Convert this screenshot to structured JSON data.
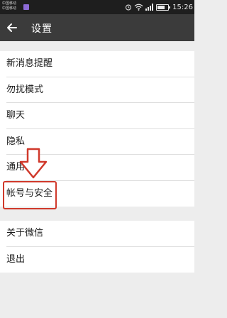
{
  "status_bar": {
    "carrier_lines": [
      "中国移动",
      "中国移动"
    ],
    "time": "15:26",
    "battery_level": 0.7,
    "icons": [
      "alarm-icon",
      "wifi-icon",
      "signal-icon",
      "battery-icon"
    ]
  },
  "title_bar": {
    "back_icon": "back-arrow-icon",
    "title": "设置"
  },
  "settings": {
    "group1": [
      {
        "label": "新消息提醒"
      },
      {
        "label": "勿扰模式"
      },
      {
        "label": "聊天"
      },
      {
        "label": "隐私"
      },
      {
        "label": "通用"
      },
      {
        "label": "帐号与安全"
      }
    ],
    "group2": [
      {
        "label": "关于微信"
      },
      {
        "label": "退出"
      }
    ]
  },
  "annotation": {
    "arrow_icon": "down-arrow-icon",
    "color": "#d0392b",
    "highlighted_item": "帐号与安全"
  }
}
